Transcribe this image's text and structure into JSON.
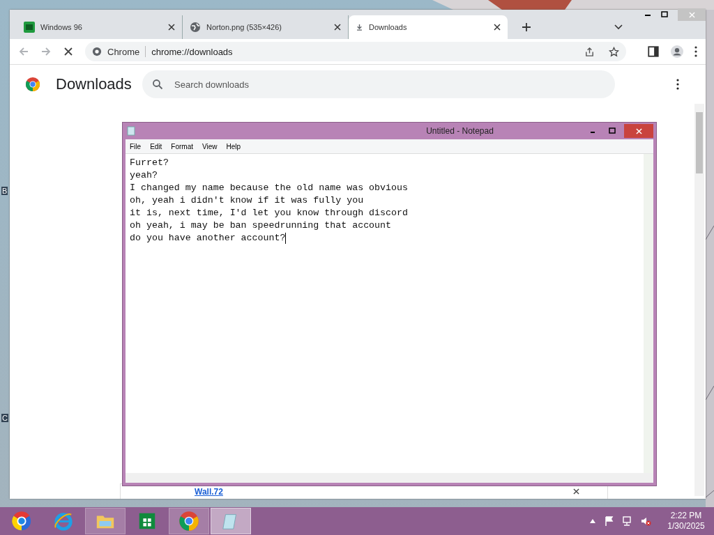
{
  "desktop": {
    "icon_labels": [
      "B",
      "C"
    ]
  },
  "browser": {
    "tabs": [
      {
        "title": "Windows 96",
        "kind": "app",
        "selected": false
      },
      {
        "title": "Norton.png (535×426)",
        "kind": "globe",
        "selected": false
      },
      {
        "title": "Downloads",
        "kind": "download",
        "selected": true
      }
    ],
    "site_label": "Chrome",
    "url": "chrome://downloads",
    "loading": true
  },
  "downloads_page": {
    "title": "Downloads",
    "search": {
      "placeholder": "Search downloads"
    },
    "items": [
      {
        "link": "Wall.72"
      }
    ]
  },
  "notepad": {
    "title": "Untitled - Notepad",
    "menu": [
      "File",
      "Edit",
      "Format",
      "View",
      "Help"
    ],
    "lines": [
      "Furret?",
      "yeah?",
      "I changed my name because the old name was obvious",
      "oh, yeah i didn't know if it was fully you",
      "it is, next time, I'd let you know through discord",
      "oh yeah, i may be ban speedrunning that account",
      "do you have another account?"
    ]
  },
  "taskbar": {
    "apps": [
      {
        "kind": "start",
        "running": false,
        "selected": false
      },
      {
        "kind": "ie",
        "running": false,
        "selected": false
      },
      {
        "kind": "explorer",
        "running": true,
        "selected": false
      },
      {
        "kind": "store",
        "running": false,
        "selected": false
      },
      {
        "kind": "chrome",
        "running": true,
        "selected": false
      },
      {
        "kind": "notepad",
        "running": true,
        "selected": true
      }
    ],
    "muted": true,
    "time": "2:22 PM",
    "date": "1/30/2025"
  }
}
